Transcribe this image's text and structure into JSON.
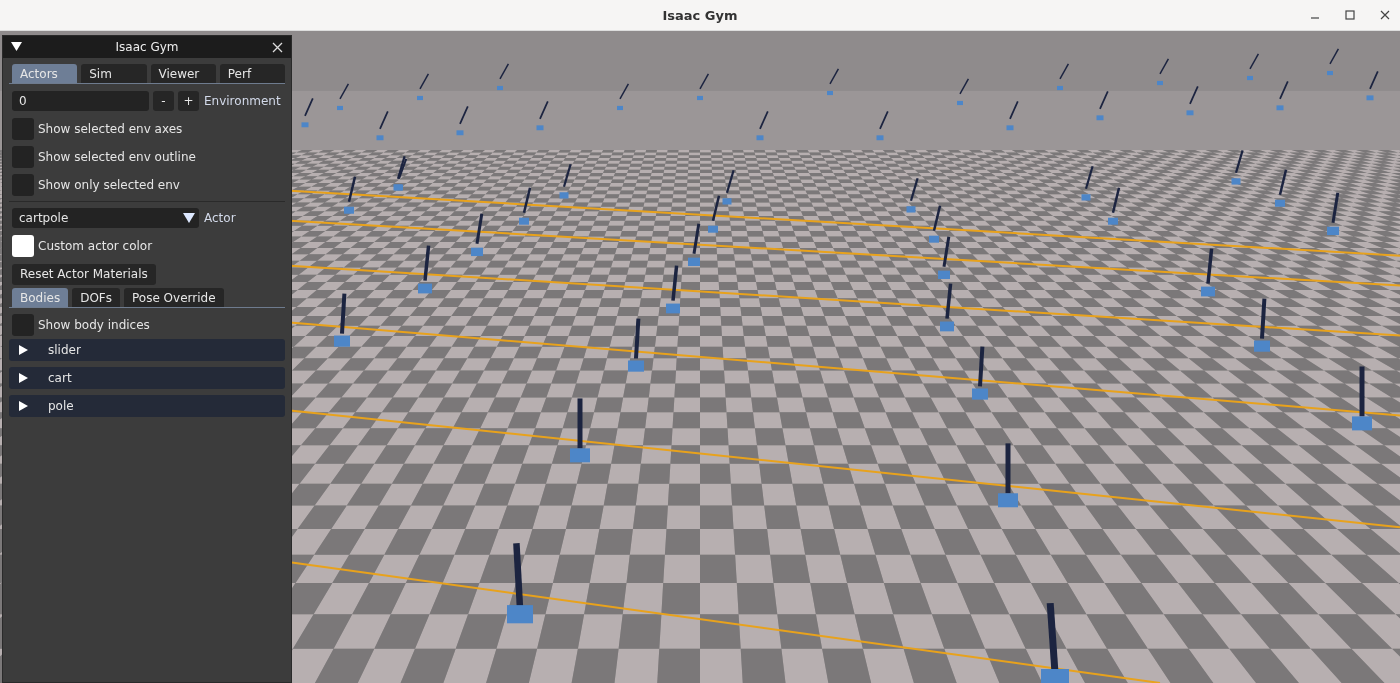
{
  "window": {
    "title": "Isaac Gym"
  },
  "panel": {
    "title": "Isaac Gym",
    "expanded": true,
    "tabs": [
      {
        "label": "Actors",
        "selected": true
      },
      {
        "label": "Sim",
        "selected": false
      },
      {
        "label": "Viewer",
        "selected": false
      },
      {
        "label": "Perf",
        "selected": false
      }
    ],
    "environment": {
      "value": "0",
      "decrement": "-",
      "increment": "+",
      "label": "Environment"
    },
    "env_options": [
      {
        "label": "Show selected env axes",
        "checked": false
      },
      {
        "label": "Show selected env outline",
        "checked": false
      },
      {
        "label": "Show only selected env",
        "checked": false
      }
    ],
    "actor": {
      "value": "cartpole",
      "label": "Actor"
    },
    "custom_color": {
      "label": "Custom actor color",
      "color": "#ffffff"
    },
    "reset_button": "Reset Actor Materials",
    "sub_tabs": [
      {
        "label": "Bodies",
        "selected": true
      },
      {
        "label": "DOFs",
        "selected": false
      },
      {
        "label": "Pose Override",
        "selected": false
      }
    ],
    "show_body_indices": {
      "label": "Show body indices",
      "checked": false
    },
    "bodies": [
      {
        "name": "slider",
        "expanded": false
      },
      {
        "name": "cart",
        "expanded": false
      },
      {
        "name": "pole",
        "expanded": false
      }
    ]
  }
}
